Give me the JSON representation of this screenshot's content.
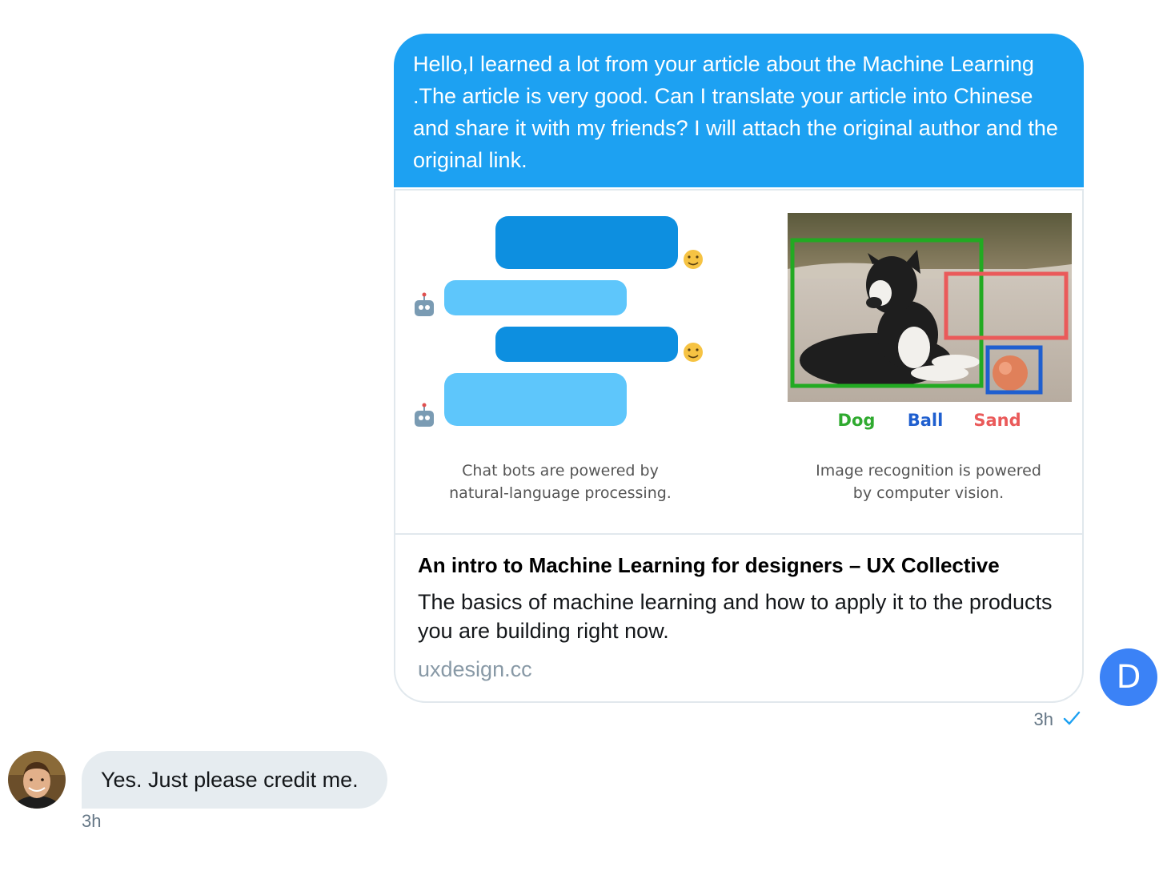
{
  "outgoing": {
    "text": "Hello,I learned a lot from your article about the Machine Learning .The article is very good. Can I translate your article into Chinese and share it with my friends? I will attach the original author and the original link.",
    "time": "3h",
    "status_icon": "check-icon",
    "avatar_initial": "D",
    "accent_color": "#1da1f2"
  },
  "link_card": {
    "image": {
      "left_caption_line1": "Chat bots are powered by",
      "left_caption_line2": "natural-language processing.",
      "right_caption_line1": "Image recognition is powered",
      "right_caption_line2": "by computer vision.",
      "labels": {
        "dog": "Dog",
        "ball": "Ball",
        "sand": "Sand"
      }
    },
    "title": "An intro to Machine Learning for designers – UX Collective",
    "description": "The basics of machine learning and how to apply it to the products you are building right now.",
    "domain": "uxdesign.cc"
  },
  "incoming": {
    "text": "Yes. Just please credit me.",
    "time": "3h",
    "bubble_color": "#e6ecf0"
  }
}
